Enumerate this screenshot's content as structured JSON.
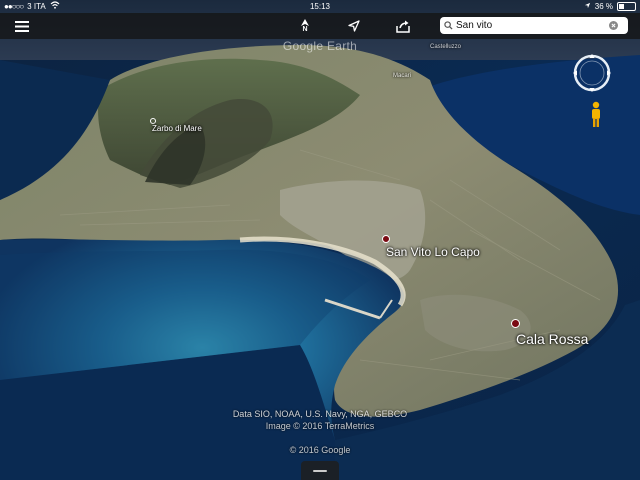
{
  "status_bar": {
    "carrier": "3 ITA",
    "time": "15:13",
    "battery": "36 %",
    "battery_level": 0.36
  },
  "toolbar": {
    "compass_label": "N",
    "search": {
      "value": "San vito",
      "placeholder": ""
    }
  },
  "map": {
    "logo": "Google Earth",
    "places": [
      {
        "name": "Zarbo di Mare"
      },
      {
        "name": "San Vito Lo Capo"
      },
      {
        "name": "Cala Rossa"
      },
      {
        "name": "Castelluzzo"
      },
      {
        "name": "Macari"
      }
    ],
    "attribution": "Data SIO, NOAA, U.S. Navy, NGA, GEBCO",
    "imagery": "Image © 2016 TerraMetrics",
    "copyright": "© 2016 Google"
  },
  "icons": {
    "menu": "hamburger-menu-icon",
    "compass": "north-arrow-icon",
    "location": "location-arrow-icon",
    "share": "share-icon",
    "search": "magnifier-icon",
    "clear": "clear-icon",
    "navigation": "navigation-ring-icon",
    "pegman": "street-view-pegman-icon"
  },
  "colors": {
    "toolbar_bg": "#1a1a1a",
    "pin": "#7a0a12",
    "pegman": "#f4b400"
  }
}
